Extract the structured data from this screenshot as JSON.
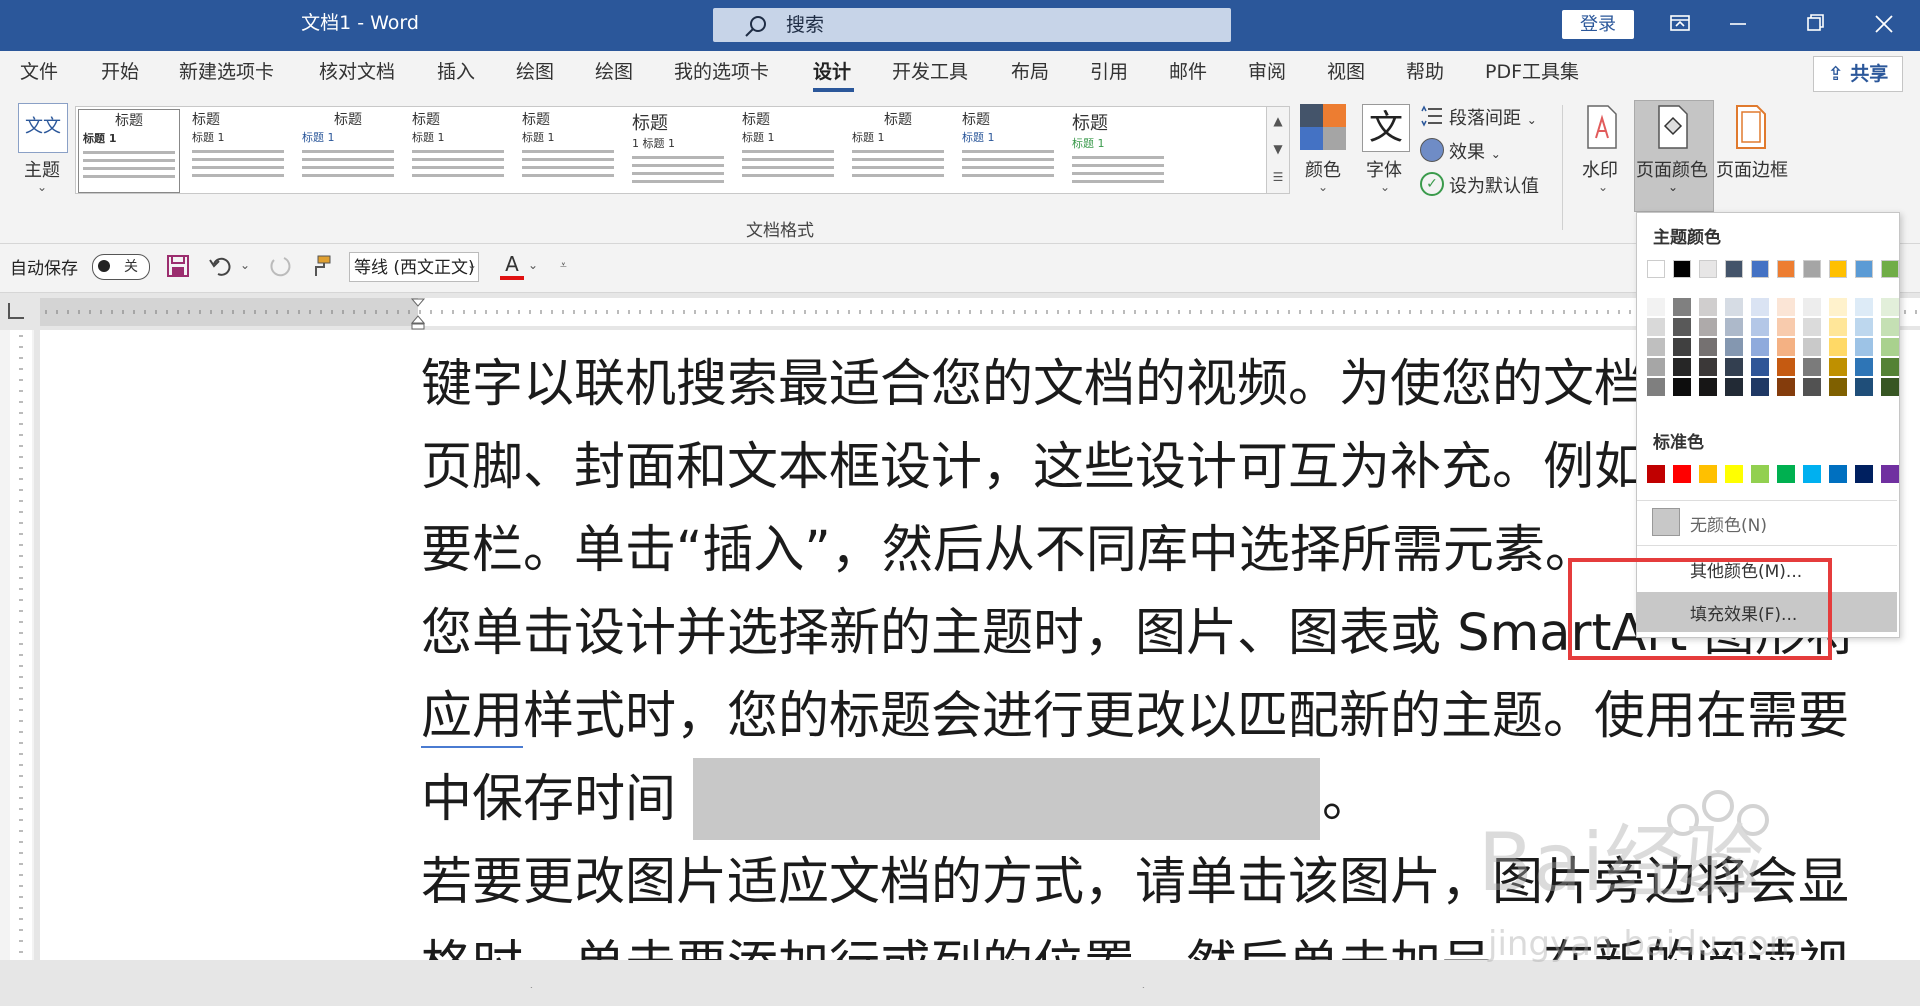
{
  "window": {
    "title": "文档1  -  Word",
    "login": "登录",
    "search_placeholder": "搜索"
  },
  "tabs": [
    "文件",
    "开始",
    "新建选项卡",
    "核对文档",
    "插入",
    "绘图",
    "绘图",
    "我的选项卡",
    "设计",
    "开发工具",
    "布局",
    "引用",
    "邮件",
    "审阅",
    "视图",
    "帮助",
    "PDF工具集"
  ],
  "active_tab": "设计",
  "share": "共享",
  "ribbon": {
    "theme": "主题",
    "theme_thumb": "文文",
    "gallery_title_items": [
      "标题",
      "标题",
      "标题",
      "标题",
      "标题",
      "标题",
      "标题",
      "标题",
      "标题",
      "标题"
    ],
    "gallery_subtitle_items": [
      "标题 1",
      "标题 1",
      "标题 1",
      "标题 1",
      "标题 1",
      "1 标题 1",
      "标题 1",
      "标题 1",
      "标题 1",
      "标题 1"
    ],
    "colors": "颜色",
    "fonts": "字体",
    "fonts_glyph": "文",
    "paragraph_spacing": "段落间距",
    "effects": "效果",
    "set_default": "设为默认值",
    "group_label": "文档格式",
    "watermark": "水印",
    "page_color": "页面颜色",
    "page_borders": "页面边框"
  },
  "qat": {
    "autosave": "自动保存",
    "autosave_state": "关",
    "font": "等线 (西文正文)"
  },
  "document": {
    "lines": [
      "键字以联机搜索最适合您的文档的视频。为使您的文档具",
      "页脚、封面和文本框设计，这些设计可互为补充。例如",
      "要栏。单击“插入”，然后从不同库中选择所需元素。",
      "您单击设计并选择新的主题时，图片、图表或 SmartArt 图形将",
      "样式时，您的标题会进行更改以匹配新的主题。使用在需要",
      "中保存时间",
      "若要更改图片适应文档的方式，请单击该图片，图片旁边将会显",
      "格时，单击要添加行或列的位置，然后单击加号。在新的阅读视"
    ],
    "line5_prefix": "应用",
    "line6_suffix": "。"
  },
  "dropdown": {
    "theme_colors_title": "主题颜色",
    "standard_colors_title": "标准色",
    "no_color": "无颜色(N)",
    "more_colors": "其他颜色(M)...",
    "fill_effects": "填充效果(F)...",
    "theme_colors": [
      "#ffffff",
      "#000000",
      "#e7e6e6",
      "#44546a",
      "#4472c4",
      "#ed7d31",
      "#a5a5a5",
      "#ffc000",
      "#5b9bd5",
      "#70ad47"
    ],
    "theme_shades": [
      [
        "#f2f2f2",
        "#808080",
        "#d0cece",
        "#d6dce4",
        "#dae3f3",
        "#fbe5d6",
        "#ededed",
        "#fff2cc",
        "#ddebf7",
        "#e2efda"
      ],
      [
        "#d9d9d9",
        "#595959",
        "#aeaaaa",
        "#adb9ca",
        "#b4c7e7",
        "#f8cbad",
        "#dbdbdb",
        "#ffe699",
        "#bdd7ee",
        "#c5e0b4"
      ],
      [
        "#bfbfbf",
        "#404040",
        "#757171",
        "#8497b0",
        "#8faadc",
        "#f4b183",
        "#c9c9c9",
        "#ffd966",
        "#9dc3e6",
        "#a9d18e"
      ],
      [
        "#a6a6a6",
        "#262626",
        "#3b3838",
        "#333f50",
        "#2f5597",
        "#c55a11",
        "#7b7b7b",
        "#bf9000",
        "#2e75b6",
        "#548235"
      ],
      [
        "#7f7f7f",
        "#0d0d0d",
        "#171616",
        "#222a35",
        "#1f3864",
        "#843c0c",
        "#525252",
        "#7f6000",
        "#1f4e79",
        "#375623"
      ]
    ],
    "standard_colors": [
      "#c00000",
      "#ff0000",
      "#ffc000",
      "#ffff00",
      "#92d050",
      "#00b050",
      "#00b0f0",
      "#0070c0",
      "#002060",
      "#7030a0"
    ]
  },
  "watermark_text": {
    "brand": "Bai经验",
    "url": "jingyan.baidu.com"
  }
}
